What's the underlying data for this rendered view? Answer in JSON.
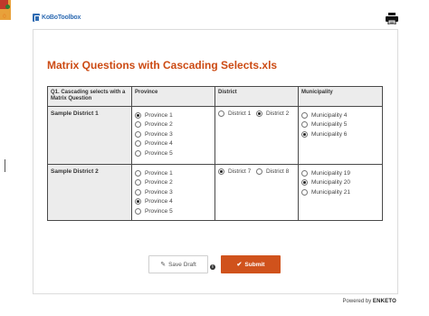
{
  "app": {
    "logo_text": "KoBoToolbox",
    "side_counter": "0"
  },
  "form": {
    "title": "Matrix Questions with Cascading Selects.xls",
    "columns": [
      "Q1. Cascading selects with a Matrix Question",
      "Province",
      "District",
      "Municipality"
    ],
    "rows": [
      {
        "label": "Sample District 1",
        "province": [
          {
            "label": "Province 1",
            "checked": true
          },
          {
            "label": "Province 2",
            "checked": false
          },
          {
            "label": "Province 3",
            "checked": false
          },
          {
            "label": "Province 4",
            "checked": false
          },
          {
            "label": "Province 5",
            "checked": false
          }
        ],
        "district": [
          {
            "label": "District 1",
            "checked": false
          },
          {
            "label": "District 2",
            "checked": true
          }
        ],
        "municipality": [
          {
            "label": "Municipality 4",
            "checked": false
          },
          {
            "label": "Municipality 5",
            "checked": false
          },
          {
            "label": "Municipality 6",
            "checked": true
          }
        ]
      },
      {
        "label": "Sample District 2",
        "province": [
          {
            "label": "Province 1",
            "checked": false
          },
          {
            "label": "Province 2",
            "checked": false
          },
          {
            "label": "Province 3",
            "checked": false
          },
          {
            "label": "Province 4",
            "checked": true
          },
          {
            "label": "Province 5",
            "checked": false
          }
        ],
        "district": [
          {
            "label": "District 7",
            "checked": true
          },
          {
            "label": "District 8",
            "checked": false
          }
        ],
        "municipality": [
          {
            "label": "Municipality 19",
            "checked": false
          },
          {
            "label": "Municipality 20",
            "checked": true
          },
          {
            "label": "Municipality 21",
            "checked": false
          }
        ]
      }
    ]
  },
  "actions": {
    "save_draft_label": "Save Draft",
    "submit_label": "Submit",
    "info_glyph": "i"
  },
  "footer": {
    "powered_by": "Powered by",
    "brand": "ENKETO"
  },
  "colors": {
    "title": "#cc4b14",
    "submit": "#d0521c",
    "logo": "#2f6cb3"
  },
  "icons": [
    "print-icon",
    "pencil-icon",
    "check-icon",
    "info-icon",
    "logo-icon"
  ]
}
